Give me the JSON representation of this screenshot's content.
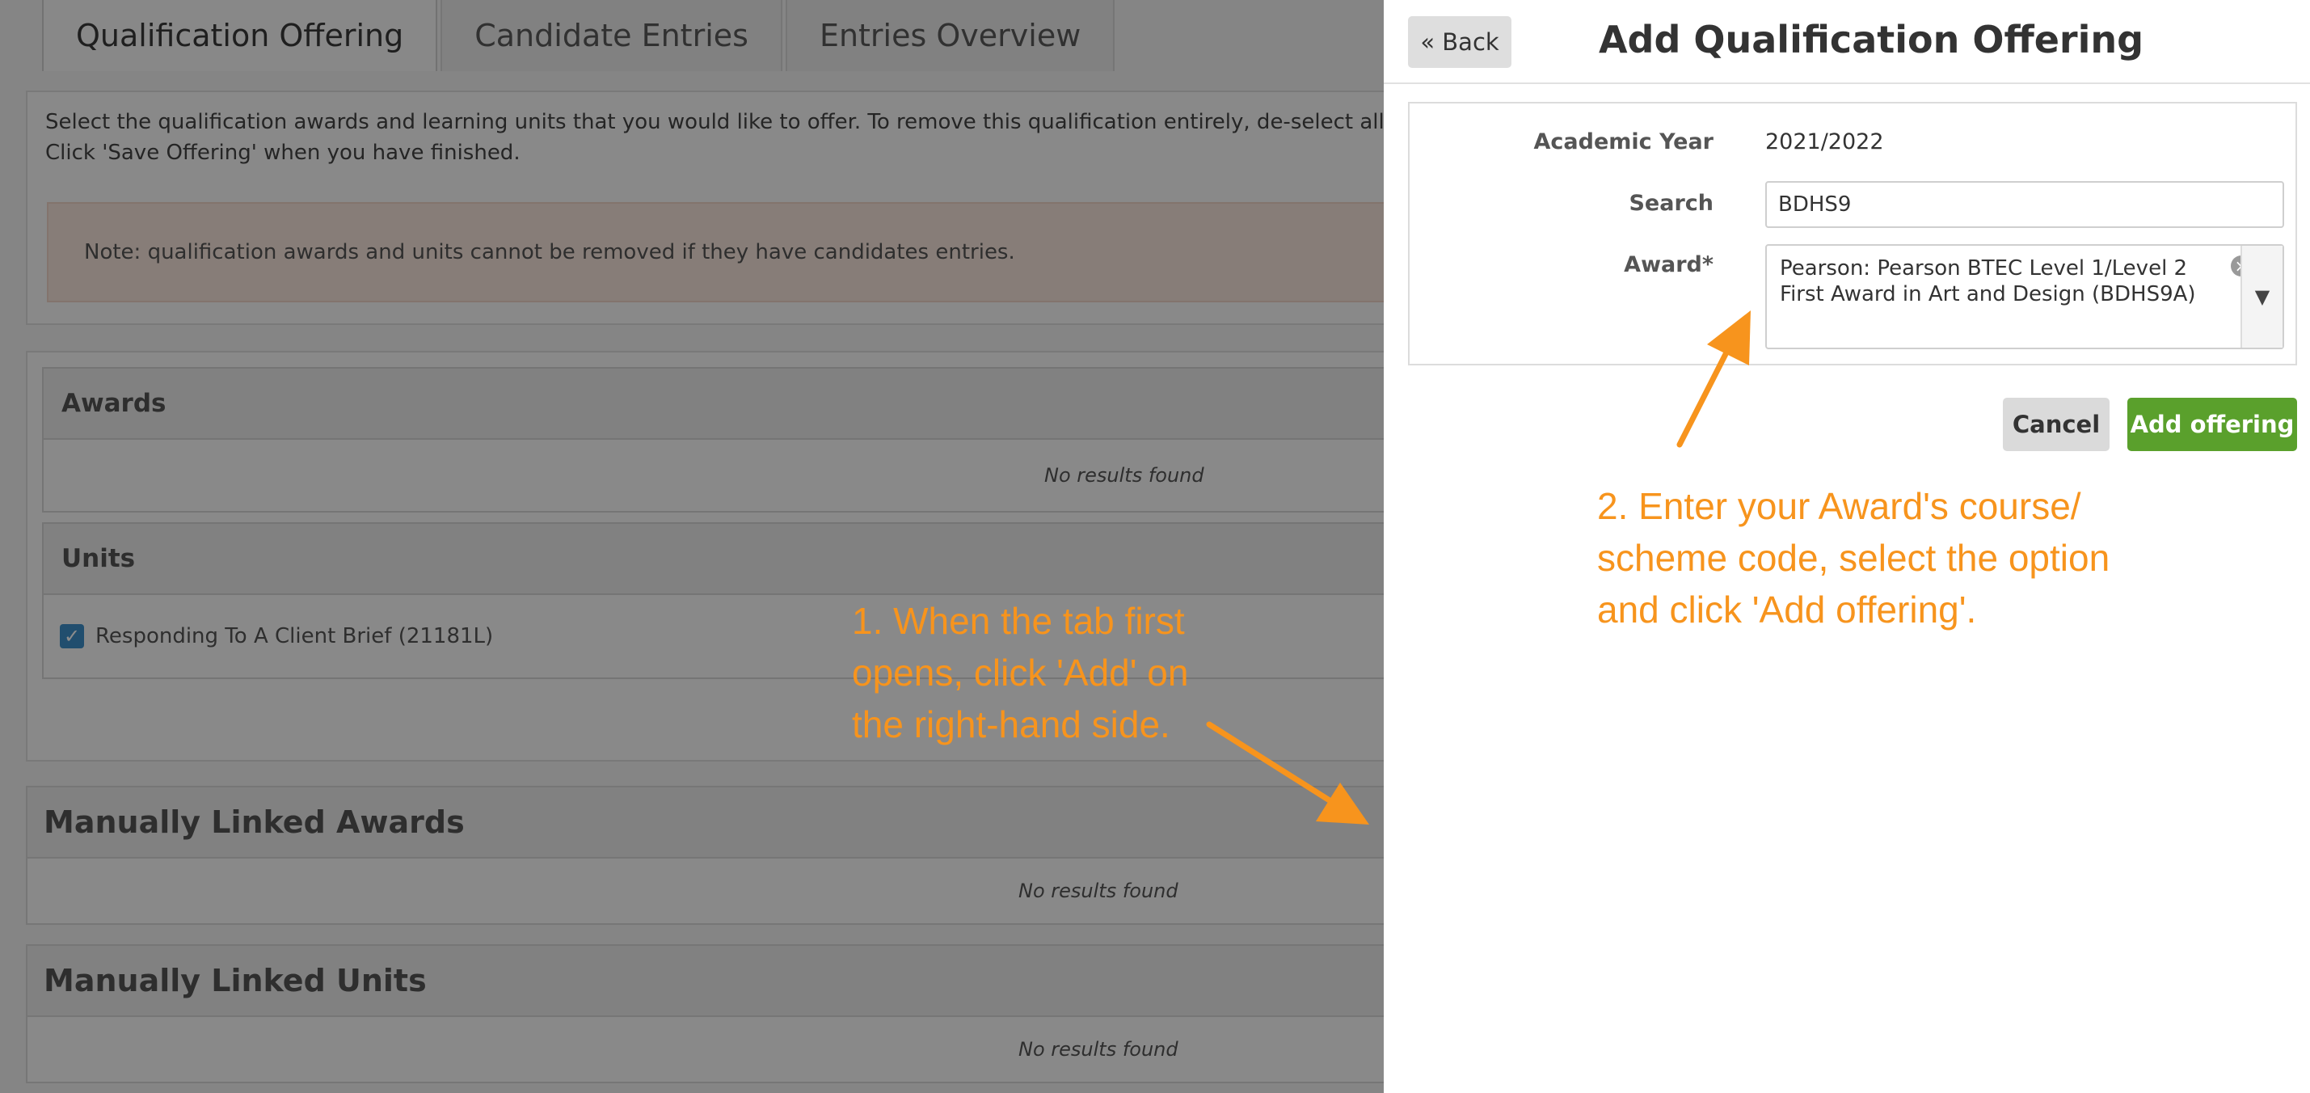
{
  "tabs": [
    {
      "label": "Qualification Offering",
      "active": true
    },
    {
      "label": "Candidate Entries",
      "active": false
    },
    {
      "label": "Entries Overview",
      "active": false
    }
  ],
  "intro": {
    "line1": "Select the qualification awards and learning units that you would like to offer. To remove this qualification entirely, de-select all of the qual",
    "line2": "Click 'Save Offering' when you have finished.",
    "note": "Note: qualification awards and units cannot be removed if they have candidates entries."
  },
  "awards_panel": {
    "title": "Awards",
    "empty": "No results found"
  },
  "units_panel": {
    "title": "Units",
    "items": [
      {
        "label": "Responding To A Client Brief (21181L)",
        "checked": true
      }
    ]
  },
  "manual_awards": {
    "title": "Manually Linked Awards",
    "empty": "No results found"
  },
  "manual_units": {
    "title": "Manually Linked Units",
    "empty": "No results found"
  },
  "drawer": {
    "back_label": "« Back",
    "title": "Add Qualification Offering",
    "academic_year_label": "Academic Year",
    "academic_year_value": "2021/2022",
    "search_label": "Search",
    "search_value": "BDHS9",
    "award_label": "Award*",
    "award_value": "Pearson: Pearson BTEC Level 1/Level 2 First Award in Art and Design (BDHS9A)",
    "cancel_label": "Cancel",
    "add_label": "Add offering"
  },
  "annotations": {
    "step1": "1. When the tab first\nopens, click 'Add' on\nthe right-hand side.",
    "step2": "2. Enter your Award's course/\nscheme code, select the option\nand click 'Add offering'."
  },
  "icons": {
    "check": "check-icon",
    "clear": "clear-icon",
    "dropdown": "chevron-down-icon"
  },
  "colors": {
    "accent_orange": "#f7941d",
    "add_green": "#5aa02c",
    "check_blue": "#3c8fc9"
  }
}
